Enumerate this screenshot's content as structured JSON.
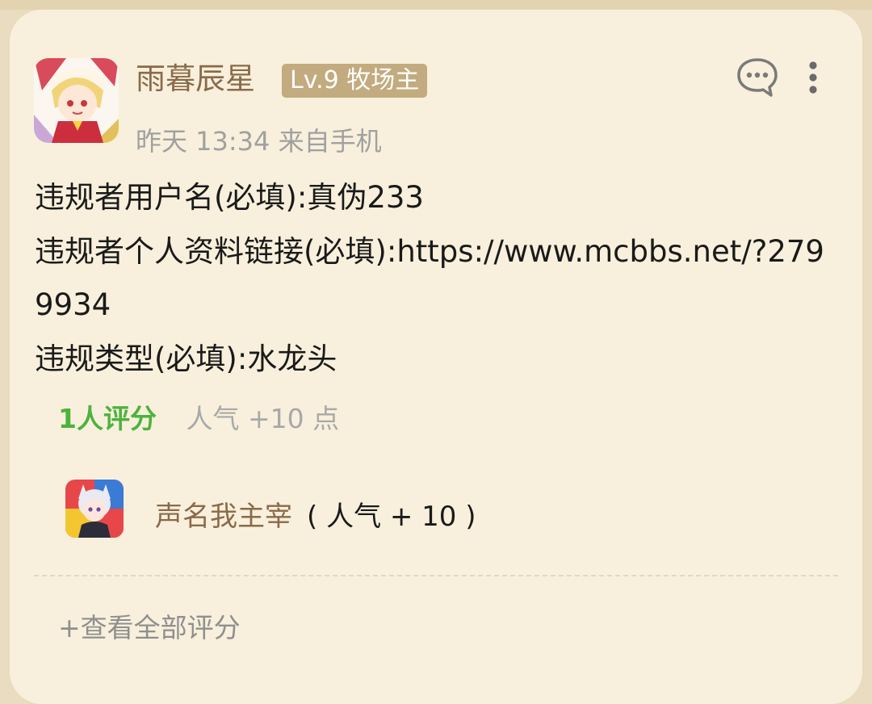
{
  "post": {
    "author": "雨暮辰星",
    "level_badge": "Lv.9 牧场主",
    "time": "昨天 13:34 来自手机",
    "lines": [
      "违规者用户名(必填):真伪233",
      "违规者个人资料链接(必填):https://www.mcbbs.net/?2799934",
      "违规类型(必填):水龙头"
    ]
  },
  "rating": {
    "count_label": "1人评分",
    "score_label": "人气 +10 点",
    "raters": [
      {
        "name": "声名我主宰",
        "points": "( 人气 + 10 )"
      }
    ],
    "view_all_label": "+查看全部评分"
  },
  "icons": {
    "comment": "comment-bubble-icon",
    "more": "more-vertical-icon"
  },
  "colors": {
    "card_bg": "#f8f0dc",
    "author": "#8a6a4a",
    "badge_bg": "#c2ab7f",
    "rating_green": "#4db33d",
    "muted": "#a0a0a0"
  }
}
